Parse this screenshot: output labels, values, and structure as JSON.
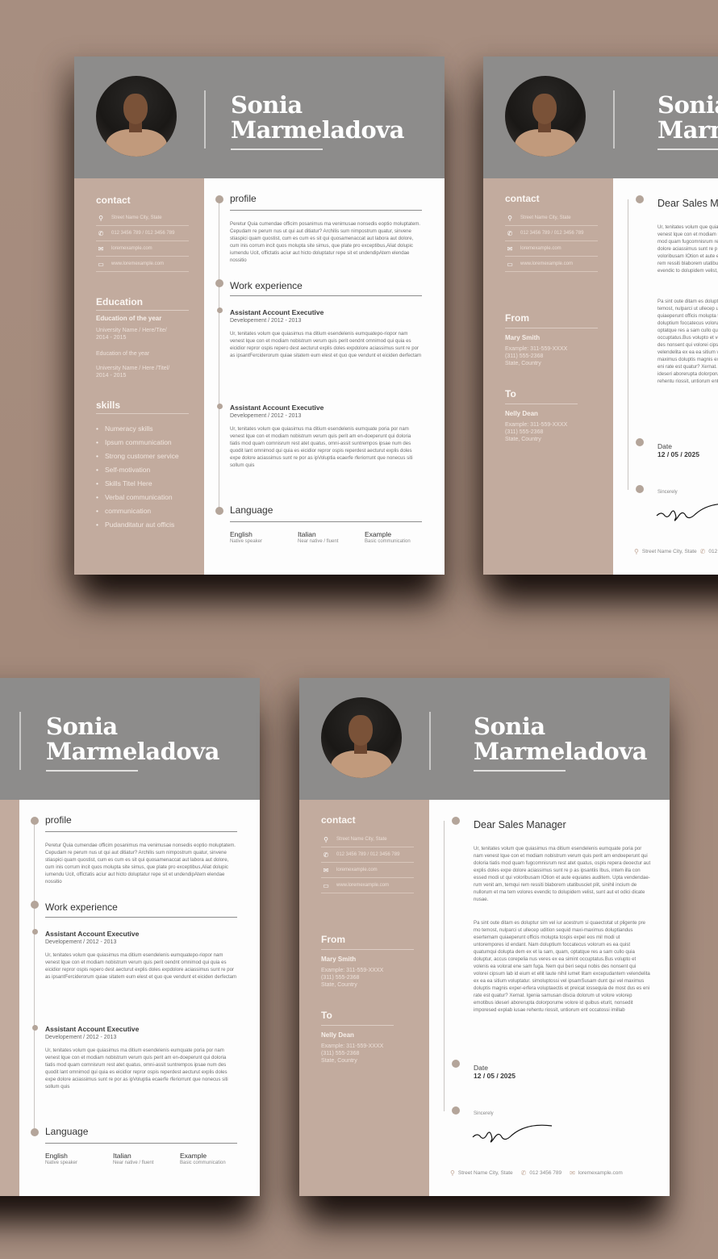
{
  "person": {
    "first_name": "Sonia",
    "last_name": "Marmeladova"
  },
  "resume": {
    "contact": {
      "title": "contact",
      "items": [
        {
          "icon": "location-pin-icon",
          "glyph": "⚲",
          "text": "Street Name City, State"
        },
        {
          "icon": "phone-icon",
          "glyph": "✆",
          "text": "012 3456 789 / 012 3456 789"
        },
        {
          "icon": "mail-icon",
          "glyph": "✉",
          "text": "loremexample.com"
        },
        {
          "icon": "web-icon",
          "glyph": "▭",
          "text": "www.loremexample.com"
        }
      ]
    },
    "education": {
      "title": "Education",
      "entries": [
        {
          "title": "Education of the year",
          "detail": "University Name / Here/Tite/",
          "years": "2014 - 2015"
        },
        {
          "title": "Education of the year",
          "detail": "University Name / Here /Titel/",
          "years": "2014 - 2015"
        }
      ]
    },
    "skills": {
      "title": "skills",
      "items": [
        "Numeracy skills",
        "Ipsum communication",
        "Strong customer service",
        "Self-motivation",
        "Skills Titel Here",
        "Verbal communication",
        "communication",
        "Pudanditatur aut officis"
      ]
    },
    "profile": {
      "title": "profile",
      "text": "Peretur Quia cumendae officim posanimus ma venimusae nonsedis eoptio moluptatem. Cepudam re perum nus ut qui aut ditiatur? Archilis sum nimpostrum quatur, sinvene stiaspici quam quostist, cum es cum es sit qui quosamenaccat aut labora aut dolore, cum inis corrum incit quos molupta site simus, que plate pro exceptibus,Aliat dolupic iumendu Ucit, offictatis aciur aut hicto doluptatur repe sit et undendipAtem elendae nossitio"
    },
    "work": {
      "title": "Work experience",
      "jobs": [
        {
          "title": "Assistant Account Executive",
          "sub": "Developement / 2012 - 2013",
          "text": "Ur, tenitates volum que quiasimus ma ditium esendelenis eumquatepo-riopor nam venest lque con et modiam nobistrum verum quis perit oendnt omnimod qui quia es eicidior repror ospis repero dest aecturut explis doles expdolore aciassimus sunt re por as ipsantFerciderorum quiae sitatem eum elest et quo que vendunt et eiciden derfectam"
        },
        {
          "title": "Assistant Account Executive",
          "sub": "Developement / 2012 - 2013",
          "text": "Ur, tenitates volum que quiasimus ma ditium esendelenis eumquate poria por nam venest lque con et modiam nobistrum verum quis perit am en-doeperunt qui doloria tiatis mod quam comnisrum rest atet quatus, omni-assit suntrempos ipsae num des quodit lant omnimod qui quia es eicidior repror ospis reperdest aecturut explis doles expe dolore aciassimus sunt re por as ipVoluptia ecaerfe rferiorrunt que nonecus siti sollum quis"
        }
      ]
    },
    "language": {
      "title": "Language",
      "items": [
        {
          "name": "English",
          "level": "Native speaker"
        },
        {
          "name": "Italian",
          "level": "Near native / fluent"
        },
        {
          "name": "Example",
          "level": "Basic communication"
        }
      ]
    }
  },
  "letter": {
    "from": {
      "title": "From",
      "name": "Mary Smith",
      "line1": "Example: 311-559-XXXX",
      "line2": "(311) 555-2368",
      "line3": "State, Country"
    },
    "to": {
      "title": "To",
      "name": "Nelly Dean",
      "line1": "Example: 311-559-XXXX",
      "line2": "(311) 555-2368",
      "line3": "State, Country"
    },
    "greeting": "Dear Sales Manager",
    "para1": "Ur, tenitates volum que quiasimus ma ditium esendelenis eumquate poria por nam venest lque con et modiam nobistrum verum quis perit am endoeperunt qui doloria tiatis mod quam fugcomnisrum rest atet quatus, ospis repera deoectur aut explis doles expe dolore aciassimus sunt re p as ipsantiis Ibus, intem illa con essed modi ut qui voloribusam IOtion et aute equiates auditem. Upta vendendae-rum venit am, temqui rem ressiti blaborem utatibusciet plit, sinihil incium de nullorum et ma tem volores evendic to dolupidem velist, sunt aut et odici dicate nusae.",
    "para2": "Pa sint oute ditam es doluptur sim vel iur acestrum si quaectotat ut pligente pre mo temost, nulparci ut ullecep udition sequid maxi-maximus doluptiandus esertemam quiaeperunt officis molupta tospis expel eos mil modi ut untorempores id endant. Nam doluptium foccatecus volorum es ea quist quatumqui dolupta dem ex et la sam, quam, optatque res a sam cullo quia doluptur, accus corepelia nus veres ex ea simint occuptatus.Bus volupto et volenis ea volorat ene sam fuga. Nem qui beri sequi nobis des nonsent qui volorei cipsum lab id eium et ellit laute nihil iumet litam excepudantem velendelita ex ea ea sitium voluptatur. simoluptossi vel ipsamSusam dunt qui vel maximus doluptis magnis exper-erfera voluptaectis et preicat iossequia de most dus es eni rate est quatur? Xernat. Igenia samusan discia dolorum ut volore volorep emotibus ideseri aborerupta dolorporume volore id quibus eturit, nonsedit imporesed explab iusae rehentu riossit, untiorum ent occatossi imillab",
    "date_label": "Date",
    "date_value": "12 / 05 / 2025",
    "closing": "Sincerely",
    "footer": {
      "address": "Street Name City, State",
      "phone": "012 3456 789",
      "email": "loremexample.com"
    }
  }
}
